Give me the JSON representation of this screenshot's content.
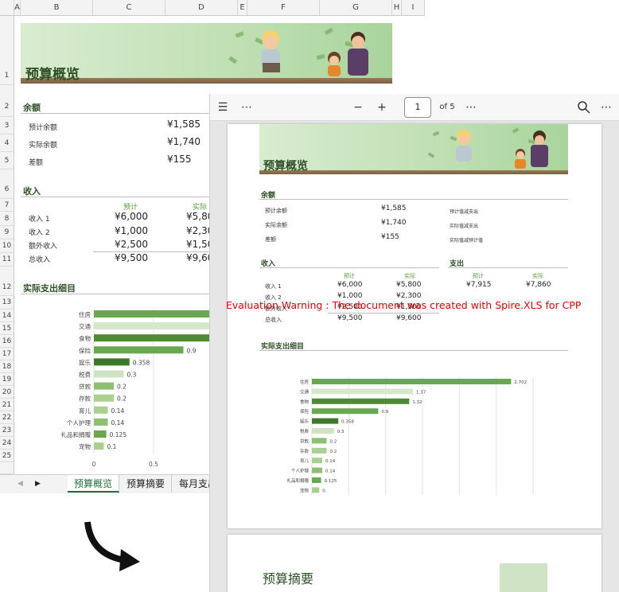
{
  "excel": {
    "columns": [
      "A",
      "B",
      "C",
      "D",
      "E",
      "F",
      "G",
      "H",
      "I"
    ],
    "rows": [
      "1",
      "2",
      "3",
      "4",
      "5",
      "6",
      "7",
      "8",
      "9",
      "10",
      "11",
      "12",
      "13",
      "14",
      "15",
      "16",
      "17",
      "18",
      "19",
      "20",
      "21",
      "22",
      "23",
      "24",
      "25"
    ],
    "banner_title": "预算概览",
    "balance": {
      "title": "余额",
      "rows": [
        {
          "label": "预计余额",
          "value": "¥1,585"
        },
        {
          "label": "实际余额",
          "value": "¥1,740"
        },
        {
          "label": "差额",
          "value": "¥155"
        }
      ]
    },
    "income": {
      "title": "收入",
      "col_planned": "预计",
      "col_actual": "实际",
      "rows": [
        {
          "label": "收入 1",
          "planned": "¥6,000",
          "actual": "¥5,80"
        },
        {
          "label": "收入 2",
          "planned": "¥1,000",
          "actual": "¥2,30"
        },
        {
          "label": "额外收入",
          "planned": "¥2,500",
          "actual": "¥1,50"
        },
        {
          "label": "总收入",
          "planned": "¥9,500",
          "actual": "¥9,60"
        }
      ]
    },
    "expense_title": "实际支出细目",
    "tabs": [
      "预算概览",
      "预算摘要",
      "每月支出"
    ],
    "active_tab": 0
  },
  "viewer": {
    "page_current": "1",
    "page_total": "of 5",
    "page1": {
      "banner_title": "预算概览",
      "balance": {
        "title": "余额",
        "rows": [
          {
            "label": "预计余额",
            "value": "¥1,585"
          },
          {
            "label": "实际余额",
            "value": "¥1,740"
          },
          {
            "label": "差额",
            "value": "¥155"
          }
        ],
        "notes": [
          "预计值减支出",
          "实际值减支出",
          "实际值减预计值"
        ]
      },
      "income": {
        "title": "收入",
        "col_planned": "预计",
        "col_actual": "实际",
        "rows": [
          {
            "label": "收入 1",
            "planned": "¥6,000",
            "actual": "¥5,800"
          },
          {
            "label": "收入 2",
            "planned": "¥1,000",
            "actual": "¥2,300"
          },
          {
            "label": "额外收入",
            "planned": "¥2,500",
            "actual": "¥1,500"
          },
          {
            "label": "总收入",
            "planned": "¥9,500",
            "actual": "¥9,600"
          }
        ]
      },
      "expense": {
        "title": "支出",
        "col_planned": "预计",
        "col_actual": "实际",
        "planned": "¥7,915",
        "actual": "¥7,860"
      },
      "breakdown_title": "实际支出细目"
    },
    "page2": {
      "title": "预算摘要"
    }
  },
  "warning": "Evaluation Warning : The document was created with  Spire.XLS for CPP",
  "colors": {
    "green_dark": "#4f8a35",
    "green_mid": "#6aa84f",
    "green_light": "#a9d08e",
    "green_pale": "#d6e8cc",
    "warning": "#e00000",
    "tab_active": "#1e6e3c"
  },
  "chart_data": [
    {
      "type": "bar",
      "orientation": "horizontal",
      "title": "",
      "categories": [
        "住房",
        "交通",
        "食物",
        "保险",
        "娱乐",
        "税费",
        "贷款",
        "存款",
        "育儿",
        "个人护理",
        "礼品和捐赠",
        "宠物"
      ],
      "values": [
        2.702,
        1.37,
        1.32,
        0.9,
        0.358,
        0.3,
        0.2,
        0.2,
        0.14,
        0.14,
        0.125,
        0.1
      ],
      "data_labels": [
        "2.702",
        "1.37",
        "1.32",
        "0.9",
        "0.358",
        "0.3",
        "0.2",
        "0.2",
        "0.14",
        "0.14",
        "0.125",
        "0.1"
      ],
      "x_ticks": [
        "0",
        "0.5",
        "1"
      ],
      "xlim": [
        0,
        1.2
      ]
    },
    {
      "type": "bar",
      "orientation": "horizontal",
      "title": "",
      "categories": [
        "住房",
        "交通",
        "食物",
        "保险",
        "娱乐",
        "税费",
        "贷款",
        "存款",
        "育儿",
        "个人护理",
        "礼品和捐赠",
        "宠物"
      ],
      "values": [
        2.702,
        1.37,
        1.32,
        0.9,
        0.358,
        0.3,
        0.2,
        0.2,
        0.14,
        0.14,
        0.125,
        0.1
      ],
      "data_labels": [
        "2.702",
        "1.37",
        "1.32",
        "0.9",
        "0.358",
        "0.3",
        "0.2",
        "0.2",
        "0.14",
        "0.14",
        "0.125",
        "0."
      ],
      "x_ticks": [
        "0",
        "0.5",
        "1",
        "1.5",
        "2",
        "2.5",
        "3"
      ],
      "x_unit": "K",
      "xlim": [
        0,
        3
      ]
    }
  ]
}
